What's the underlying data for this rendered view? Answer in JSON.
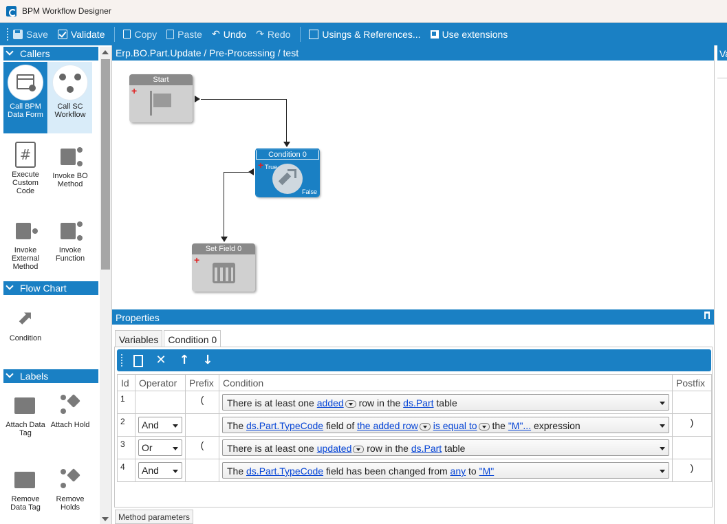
{
  "window": {
    "title": "BPM Workflow Designer"
  },
  "toolbar": {
    "save": "Save",
    "validate": "Validate",
    "copy": "Copy",
    "paste": "Paste",
    "undo": "Undo",
    "redo": "Redo",
    "usings": "Usings & References...",
    "extensions": "Use extensions"
  },
  "palette": {
    "callers": {
      "header": "Callers",
      "items": [
        "Call BPM Data Form",
        "Call SC Workflow",
        "Execute Custom Code",
        "Invoke BO Method",
        "Invoke External Method",
        "Invoke Function"
      ]
    },
    "flowchart": {
      "header": "Flow Chart",
      "items": [
        "Condition"
      ]
    },
    "labels": {
      "header": "Labels",
      "items": [
        "Attach Data Tag",
        "Attach Hold",
        "Remove Data Tag",
        "Remove Holds"
      ]
    }
  },
  "canvas": {
    "path": "Erp.BO.Part.Update / Pre-Processing / test",
    "right_header": "Va",
    "nodes": {
      "start": "Start",
      "condition": "Condition 0",
      "true_label": "True",
      "false_label": "False",
      "setfield": "Set Field 0"
    }
  },
  "properties": {
    "header": "Properties",
    "tabs": [
      "Variables",
      "Condition 0"
    ],
    "columns": [
      "Id",
      "Operator",
      "Prefix",
      "Condition",
      "Postfix"
    ],
    "rows": [
      {
        "id": "1",
        "operator": "",
        "prefix": "(",
        "postfix": "",
        "c": {
          "t1": "There is at least one ",
          "l1": "added",
          "t2": " row in the ",
          "l2": "ds.Part",
          "t3": " table"
        }
      },
      {
        "id": "2",
        "operator": "And",
        "prefix": "",
        "postfix": ")",
        "c": {
          "t1": "The ",
          "l1": "ds.Part.TypeCode",
          "t2": " field of ",
          "l2": "the added row",
          "t3": " ",
          "l3": "is equal to",
          "t4": " the ",
          "l4": "\"M\"...",
          "t5": " expression"
        }
      },
      {
        "id": "3",
        "operator": "Or",
        "prefix": "(",
        "postfix": "",
        "c": {
          "t1": "There is at least one ",
          "l1": "updated",
          "t2": " row in the ",
          "l2": "ds.Part",
          "t3": " table"
        }
      },
      {
        "id": "4",
        "operator": "And",
        "prefix": "",
        "postfix": ")",
        "c": {
          "t1": "The ",
          "l1": "ds.Part.TypeCode",
          "t2": " field has been changed from ",
          "l2": "any",
          "t3": " to ",
          "l3": "\"M\""
        }
      }
    ],
    "bottom_tab": "Method parameters"
  },
  "colors": {
    "accent": "#1a80c4",
    "link": "#0645d6",
    "plus": "#e02020"
  },
  "icons": [
    "save-icon",
    "validate-icon",
    "copy-icon",
    "paste-icon",
    "undo-icon",
    "redo-icon",
    "usings-icon",
    "extensions-icon",
    "new-row-icon",
    "delete-row-icon",
    "move-up-icon",
    "move-down-icon",
    "pin-icon"
  ]
}
